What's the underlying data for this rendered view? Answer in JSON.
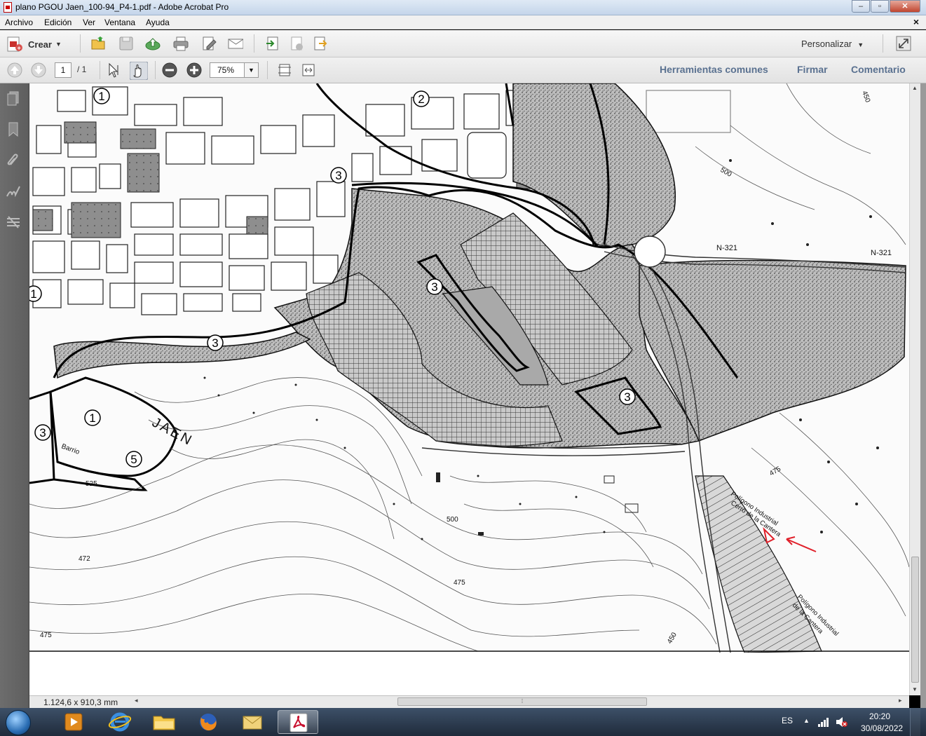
{
  "window": {
    "title": "plano PGOU Jaen_100-94_P4-1.pdf - Adobe Acrobat Pro"
  },
  "menu": {
    "items": [
      "Archivo",
      "Edición",
      "Ver",
      "Ventana",
      "Ayuda"
    ]
  },
  "toolbar": {
    "crear_label": "Crear",
    "personalizar_label": "Personalizar",
    "page_current": "1",
    "page_total": "/ 1",
    "zoom_value": "75%"
  },
  "panels": {
    "herramientas": "Herramientas comunes",
    "firmar": "Firmar",
    "comentario": "Comentario"
  },
  "status": {
    "page_size": "1.124,6 x 910,3 mm"
  },
  "map_labels": {
    "zone1": "1",
    "zone2": "2",
    "zone3": "3",
    "zone5": "5",
    "city": "JAEN",
    "road": "N-321",
    "barrio": "Barrio",
    "contour_500": "500",
    "contour_525": "525",
    "contour_475": "475",
    "contour_450": "450",
    "contour_472": "472",
    "poligono_1": "Polígono Industrial",
    "poligono_1b": "Cerro de la Cantera",
    "poligono_2": "Polígono Industrial",
    "poligono_2b": "de la Cantera"
  },
  "taskbar": {
    "apps": [
      "media-player",
      "internet-explorer",
      "file-explorer",
      "firefox",
      "mail",
      "adobe-acrobat"
    ],
    "lang": "ES",
    "time": "20:20",
    "date": "30/08/2022"
  },
  "colors": {
    "annotation": "#e0202a",
    "panel_link": "#5a7190",
    "taskbar": "#2a3a50"
  }
}
